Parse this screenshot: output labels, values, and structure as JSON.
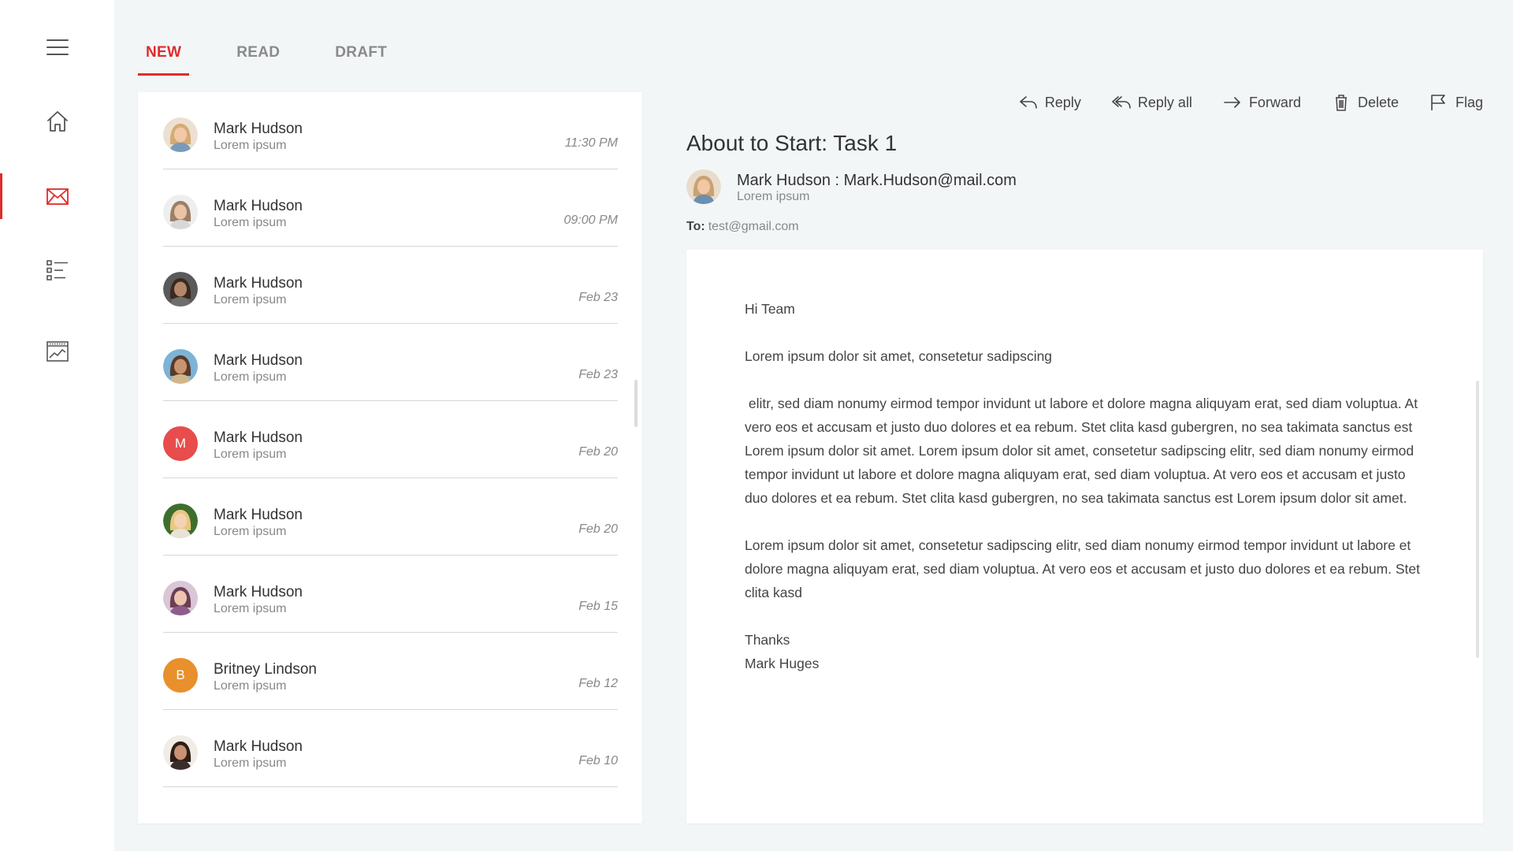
{
  "sidebar": {
    "items": [
      {
        "name": "menu-icon"
      },
      {
        "name": "home-icon"
      },
      {
        "name": "mail-icon",
        "active": true
      },
      {
        "name": "list-icon"
      },
      {
        "name": "analytics-icon"
      }
    ],
    "accent": "#e02b2b"
  },
  "tabs": [
    {
      "label": "NEW",
      "active": true
    },
    {
      "label": "READ"
    },
    {
      "label": "DRAFT"
    }
  ],
  "messages": [
    {
      "name": "Mark Hudson",
      "preview": "Lorem ipsum",
      "time": "11:30  PM",
      "avatar": "photo-woman-blonde"
    },
    {
      "name": "Mark Hudson",
      "preview": "Lorem ipsum",
      "time": "09:00  PM",
      "avatar": "photo-man-light"
    },
    {
      "name": "Mark Hudson",
      "preview": "Lorem ipsum",
      "time": "Feb 23",
      "avatar": "photo-man-dark"
    },
    {
      "name": "Mark Hudson",
      "preview": "Lorem ipsum",
      "time": "Feb 23",
      "avatar": "photo-woman-beach"
    },
    {
      "name": "Mark Hudson",
      "preview": "Lorem ipsum",
      "time": "Feb 20",
      "avatar": "M",
      "avatar_color": "#e84c4c"
    },
    {
      "name": "Mark Hudson",
      "preview": "Lorem ipsum",
      "time": "Feb 20",
      "avatar": "photo-woman-smile"
    },
    {
      "name": "Mark Hudson",
      "preview": "Lorem ipsum",
      "time": "Feb 15",
      "avatar": "photo-woman-purple"
    },
    {
      "name": "Britney Lindson",
      "preview": "Lorem ipsum",
      "time": "Feb 12",
      "avatar": "B",
      "avatar_color": "#e8902c"
    },
    {
      "name": "Mark Hudson",
      "preview": "Lorem ipsum",
      "time": "Feb 10",
      "avatar": "photo-woman-dark"
    }
  ],
  "toolbar": {
    "reply": "Reply",
    "reply_all": "Reply all",
    "forward": "Forward",
    "delete": "Delete",
    "flag": "Flag"
  },
  "email": {
    "subject": "About to Start: Task 1",
    "sender": "Mark Hudson : Mark.Hudson@mail.com",
    "sender_sub": "Lorem ipsum",
    "to_label": "To:",
    "to": "test@gmail.com",
    "greeting": "Hi Team",
    "p1": "Lorem ipsum dolor sit amet, consetetur sadipscing",
    "p2": " elitr, sed diam nonumy eirmod tempor invidunt ut labore et dolore magna aliquyam erat, sed diam voluptua. At vero eos et accusam et justo duo dolores et ea rebum. Stet clita kasd gubergren, no sea takimata sanctus est Lorem ipsum dolor sit amet. Lorem ipsum dolor sit amet, consetetur sadipscing elitr, sed diam nonumy eirmod tempor invidunt ut labore et dolore magna aliquyam erat, sed diam voluptua. At vero eos et accusam et justo duo dolores et ea rebum. Stet clita kasd gubergren, no sea takimata sanctus est Lorem ipsum dolor sit amet.",
    "p3": "Lorem ipsum dolor sit amet, consetetur sadipscing elitr, sed diam nonumy eirmod tempor invidunt ut labore et dolore magna aliquyam erat, sed diam voluptua. At vero eos et accusam et justo duo dolores et ea rebum. Stet clita kasd",
    "closing": "Thanks",
    "signature": "Mark Huges"
  }
}
